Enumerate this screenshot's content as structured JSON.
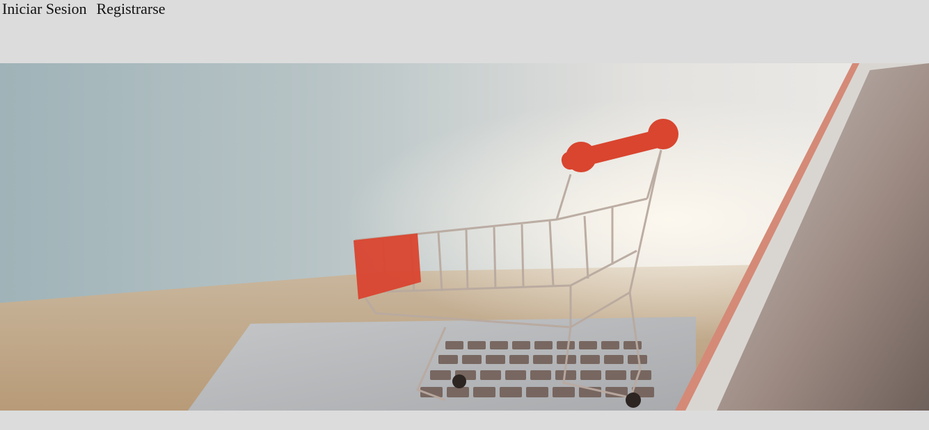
{
  "nav": {
    "login_label": "Iniciar Sesion",
    "register_label": "Registrarse"
  },
  "hero": {
    "image_subject": "shopping-cart-on-laptop"
  },
  "colors": {
    "page_background": "#dcdcdc",
    "cart_accent": "#d9452f"
  }
}
